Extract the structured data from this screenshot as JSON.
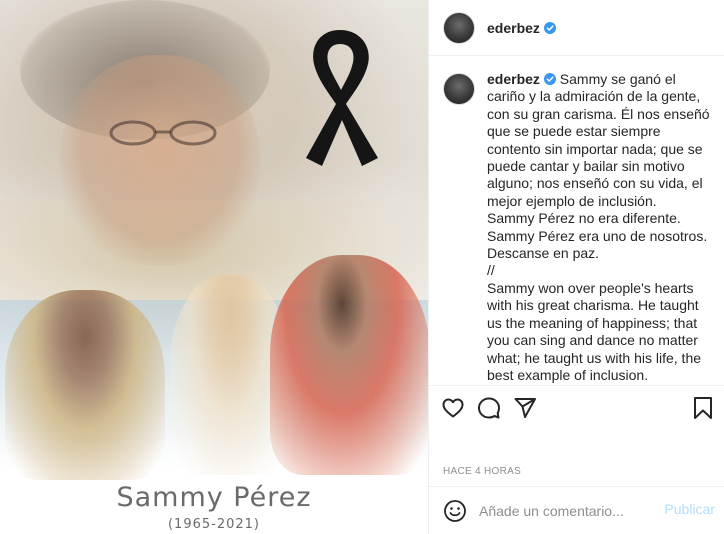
{
  "post": {
    "media": {
      "name": "Sammy Pérez",
      "years": "(1965-2021)"
    },
    "header": {
      "username": "ederbez",
      "verified_icon": "verified-badge-icon"
    },
    "caption": {
      "username": "ederbez",
      "text": " Sammy se ganó el cariño y la admiración de la gente, con su gran carisma. Él nos enseñó que se puede estar siempre contento sin importar nada; que se puede cantar y bailar sin motivo alguno; nos enseñó con su vida, el mejor ejemplo de inclusión.\nSammy Pérez no era diferente.\nSammy Pérez era uno de nosotros.\nDescanse en paz.\n//\nSammy won over people's hearts with his great charisma. He taught us the meaning of happiness; that you can sing and dance no matter what; he taught us with his life, the best example of inclusion.\nSammy Pérez was no different.\nSammy Pérez was one of us."
    },
    "timestamp": "HACE 4 HORAS",
    "comment_box": {
      "placeholder": "Añade un comentario...",
      "post_label": "Publicar"
    },
    "colors": {
      "verified_blue": "#3897f0",
      "post_button_disabled": "#b2dffc",
      "muted_text": "#8e8e8e"
    }
  }
}
